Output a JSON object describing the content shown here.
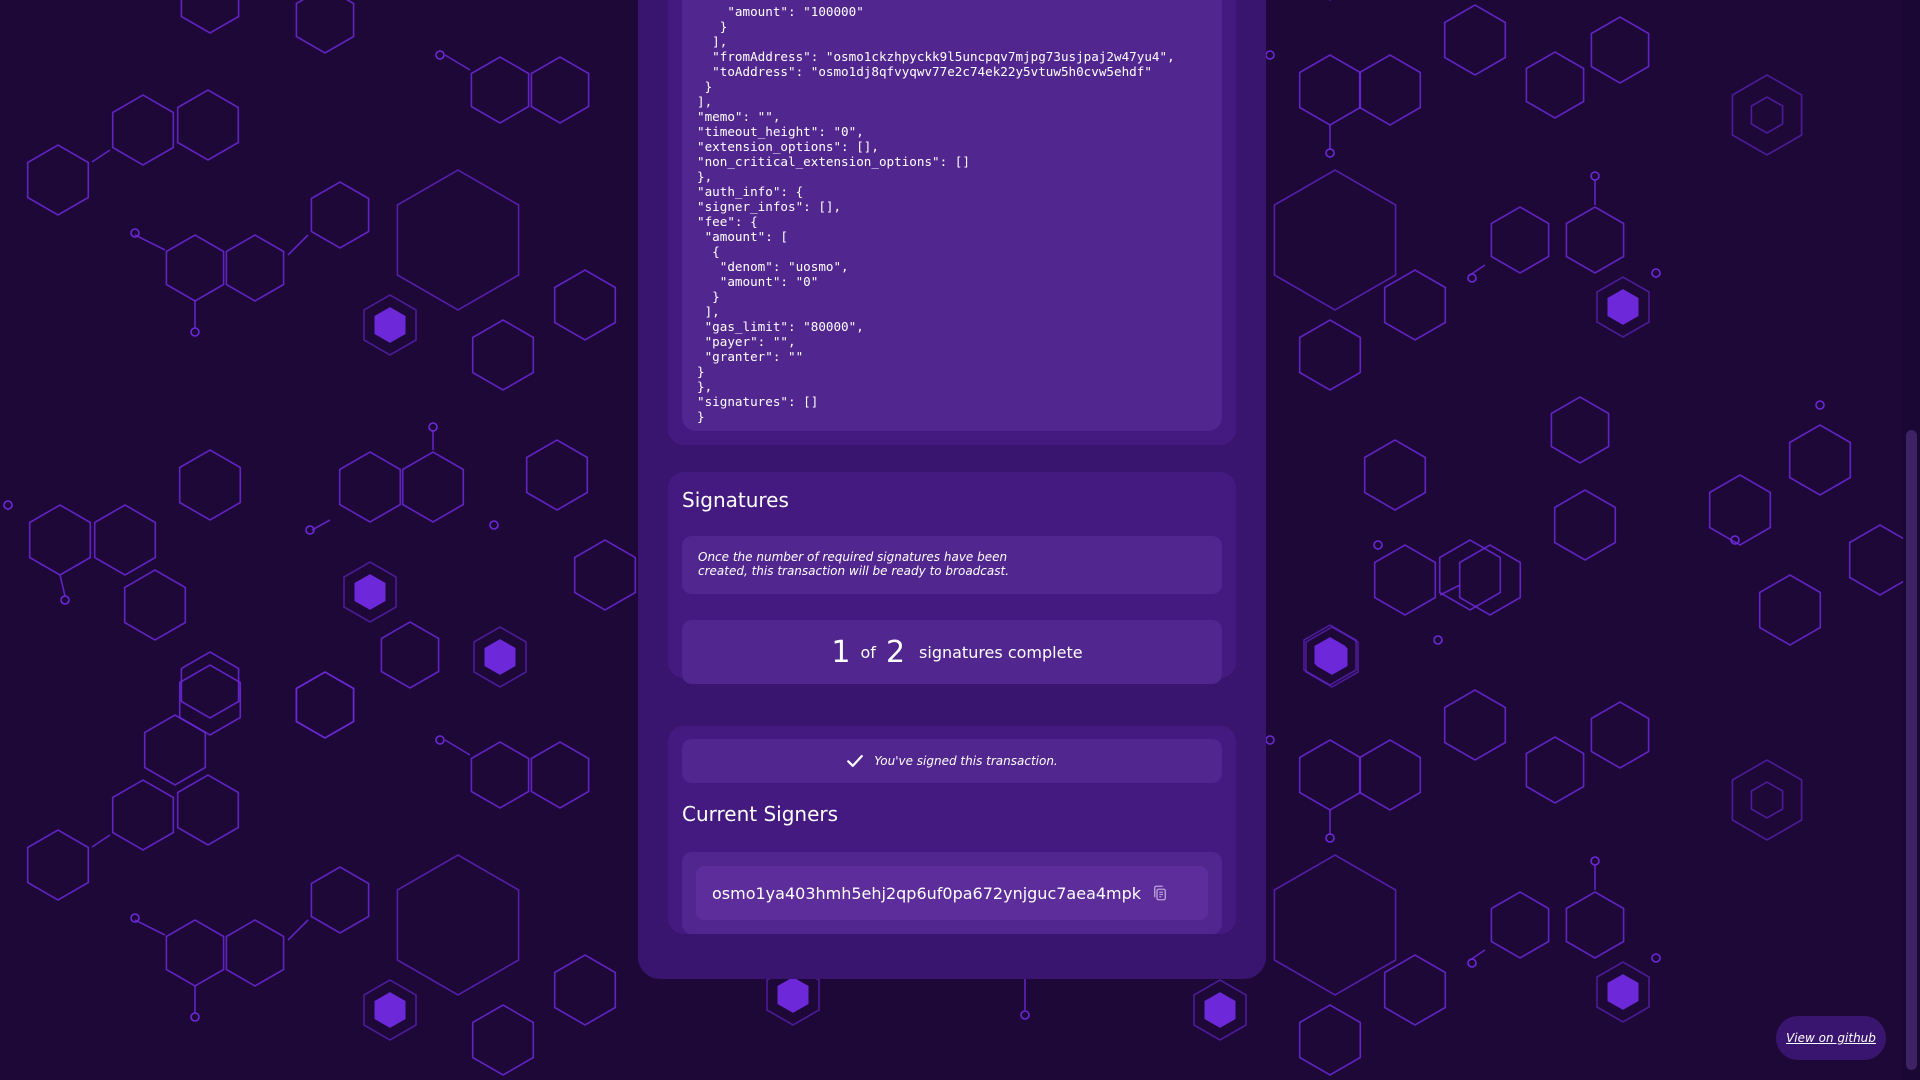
{
  "transaction_json": "    \"amount\": \"100000\"\n   }\n  ],\n  \"fromAddress\": \"osmo1ckzhpyckk9l5uncpqv7mjpg73usjpaj2w47yu4\",\n  \"toAddress\": \"osmo1dj8qfvyqwv77e2c74ek22y5vtuw5h0cvw5ehdf\"\n }\n],\n\"memo\": \"\",\n\"timeout_height\": \"0\",\n\"extension_options\": [],\n\"non_critical_extension_options\": []\n},\n\"auth_info\": {\n\"signer_infos\": [],\n\"fee\": {\n \"amount\": [\n  {\n   \"denom\": \"uosmo\",\n   \"amount\": \"0\"\n  }\n ],\n \"gas_limit\": \"80000\",\n \"payer\": \"\",\n \"granter\": \"\"\n}\n},\n\"signatures\": []\n}",
  "signatures": {
    "title": "Signatures",
    "info_text": "Once the number of required signatures have been created, this transaction will be ready to broadcast.",
    "signed_count": "1",
    "of_label": "of",
    "required_count": "2",
    "complete_label": "signatures complete"
  },
  "signers": {
    "signed_message": "You've signed this transaction.",
    "title": "Current Signers",
    "items": [
      {
        "address": "osmo1ya403hmh5ehj2qp6uf0pa672ynjguc7aea4mpk"
      }
    ]
  },
  "github_button": "View on github",
  "icons": {
    "check": "check-icon",
    "copy": "copy-icon"
  },
  "colors": {
    "background": "#1d0838",
    "card": "#3a1570",
    "section": "#451a80",
    "box": "#52268f",
    "hexagon_stroke": "#6d28d9",
    "hexagon_fill": "#6d28d9"
  }
}
